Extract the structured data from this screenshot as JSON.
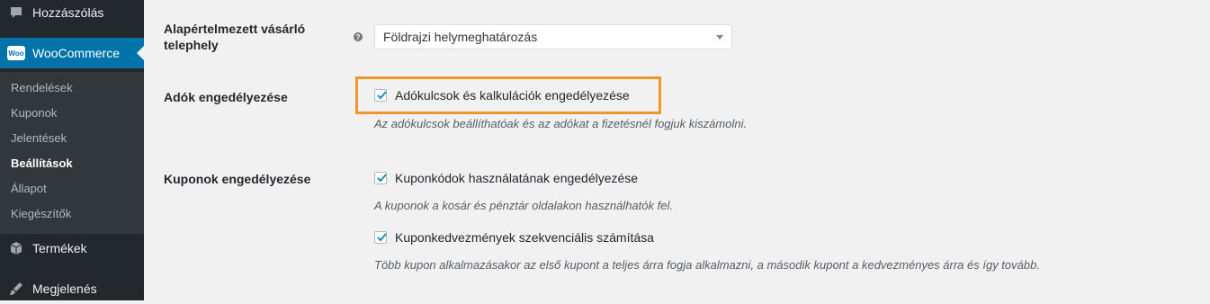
{
  "sidebar": {
    "comments_label": "Hozzászólás",
    "woocommerce_label": "WooCommerce",
    "woo_badge": "Woo",
    "submenu": [
      {
        "label": "Rendelések"
      },
      {
        "label": "Kuponok"
      },
      {
        "label": "Jelentések"
      },
      {
        "label": "Beállítások"
      },
      {
        "label": "Állapot"
      },
      {
        "label": "Kiegészítők"
      }
    ],
    "products_label": "Termékek",
    "appearance_label": "Megjelenés"
  },
  "settings": {
    "default_location": {
      "label": "Alapértelmezett vásárló telephely",
      "help": "?",
      "selected": "Földrajzi helymeghatározás"
    },
    "taxes": {
      "label": "Adók engedélyezése",
      "checkbox_label": "Adókulcsok és kalkulációk engedélyezése",
      "checked": true,
      "description": "Az adókulcsok beállíthatóak és az adókat a fizetésnél fogjuk kiszámolni."
    },
    "coupons": {
      "label": "Kuponok engedélyezése",
      "checkbox1_label": "Kuponkódok használatának engedélyezése",
      "checkbox1_checked": true,
      "description1": "A kuponok a kosár és pénztár oldalakon használhatók fel.",
      "checkbox2_label": "Kuponkedvezmények szekvenciális számítása",
      "checkbox2_checked": true,
      "description2": "Több kupon alkalmazásakor az első kupont a teljes árra fogja alkalmazni, a második kupont a kedvezményes árra és így tovább."
    }
  },
  "colors": {
    "sidebar_bg": "#23282d",
    "accent": "#0073aa",
    "highlight": "#f0962a"
  }
}
